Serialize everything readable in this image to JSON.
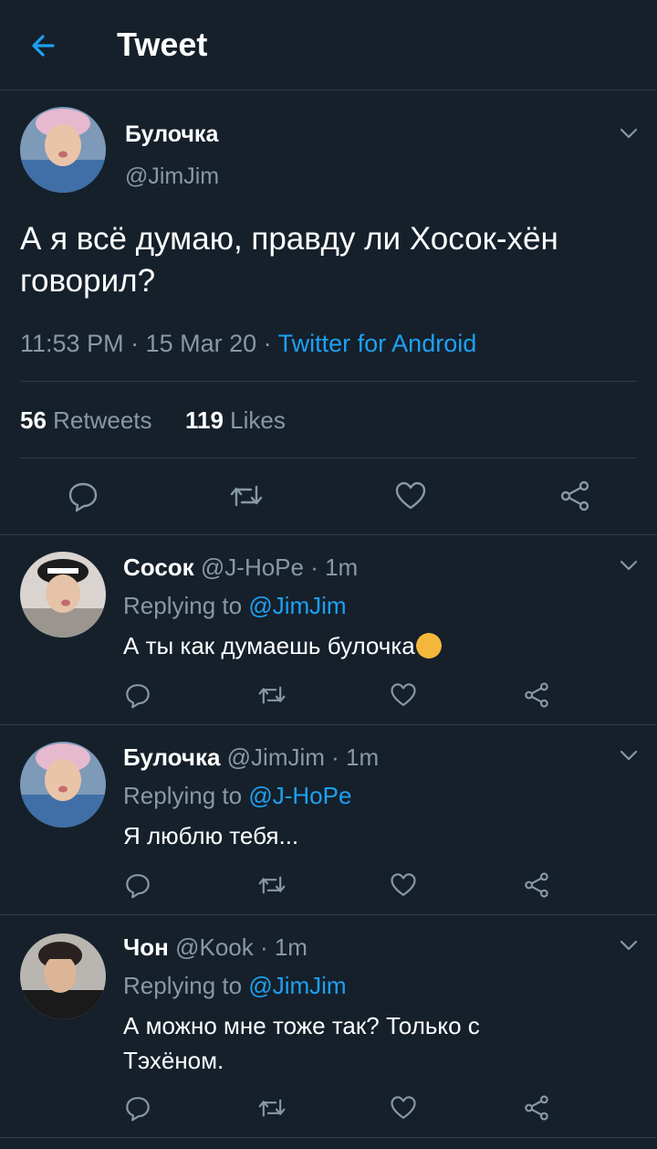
{
  "header": {
    "title": "Tweet"
  },
  "main_tweet": {
    "name": "Булочка",
    "handle": "@JimJim",
    "text": "А я всё думаю, правду ли Хосок-хён говорил?",
    "time": "11:53 PM · 15 Mar 20 · ",
    "source": "Twitter for Android",
    "retweets_count": "56",
    "retweets_label": " Retweets",
    "likes_count": "119",
    "likes_label": " Likes"
  },
  "replies": [
    {
      "name": "Сосок",
      "meta": " @J-HoPe · 1m",
      "replying_prefix": "Replying to ",
      "replying_to": "@JimJim",
      "text": "А ты как думаешь булочка",
      "emoji": "😘"
    },
    {
      "name": "Булочка",
      "meta": " @JimJim · 1m",
      "replying_prefix": "Replying to ",
      "replying_to": "@J-HoPe",
      "text": "Я люблю тебя..."
    },
    {
      "name": "Чон",
      "meta": " @Kook · 1m",
      "replying_prefix": "Replying to ",
      "replying_to": "@JimJim",
      "text": "А можно мне тоже так? Только с Тэхёном."
    }
  ],
  "colors": {
    "background": "#15202b",
    "accent": "#1da1f2",
    "muted": "#8899a6",
    "separator": "#2f3b47",
    "emoji_face": "#f5b73b"
  },
  "icons": [
    "back-arrow-icon",
    "chevron-down-icon",
    "reply-icon",
    "retweet-icon",
    "like-icon",
    "share-icon"
  ]
}
